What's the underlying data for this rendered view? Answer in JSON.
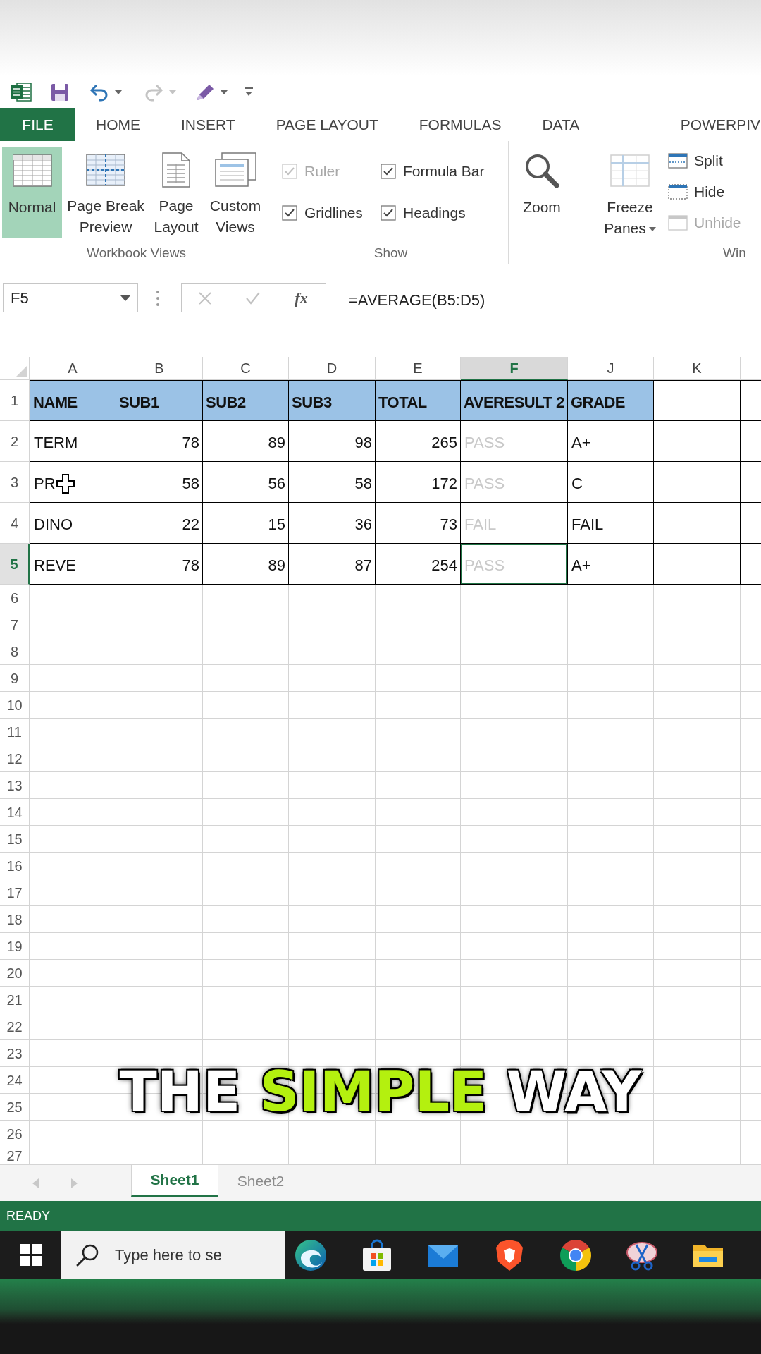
{
  "quick_access": [
    {
      "kind": "app"
    },
    {
      "kind": "save"
    },
    {
      "kind": "undo",
      "disabled": false
    },
    {
      "kind": "redo",
      "disabled": true
    },
    {
      "kind": "touch"
    },
    {
      "kind": "customize"
    }
  ],
  "ribbon_tabs": [
    {
      "label": "FILE",
      "kind": "backstage"
    },
    {
      "label": "HOME",
      "kind": "tab"
    },
    {
      "label": "INSERT",
      "kind": "tab"
    },
    {
      "label": "PAGE LAYOUT",
      "kind": "tab"
    },
    {
      "label": "FORMULAS",
      "kind": "tab"
    },
    {
      "label": "DATA",
      "kind": "tab"
    },
    {
      "label": "POWERPIV",
      "kind": "tab"
    }
  ],
  "ribbon": {
    "groups": [
      {
        "label": "Workbook Views",
        "kind": "views",
        "buttons": [
          {
            "label": "Normal",
            "kind": "normal",
            "selected": true
          },
          {
            "label": "Page Break Preview",
            "kind": "page_break",
            "selected": false
          },
          {
            "label": "Page Layout",
            "kind": "page_layout",
            "selected": false
          },
          {
            "label": "Custom Views",
            "kind": "custom",
            "selected": false
          }
        ]
      },
      {
        "label": "Show",
        "kind": "checks",
        "checkboxes": [
          {
            "label": "Ruler",
            "checked": true,
            "disabled": true
          },
          {
            "label": "Formula Bar",
            "checked": true,
            "disabled": false
          },
          {
            "label": "Gridlines",
            "checked": true,
            "disabled": false
          },
          {
            "label": "Headings",
            "checked": true,
            "disabled": false
          }
        ]
      },
      {
        "kind": "zoom",
        "buttons": [
          {
            "label": "Zoom",
            "kind": "zoom"
          },
          {
            "label": "Freeze Panes",
            "kind": "freeze"
          }
        ]
      },
      {
        "label": "Win",
        "kind": "window",
        "buttons": [
          {
            "label": "Split",
            "kind": "split",
            "disabled": false
          },
          {
            "label": "Hide",
            "kind": "hide",
            "disabled": false
          },
          {
            "label": "Unhide",
            "kind": "unhide",
            "disabled": true
          }
        ]
      }
    ]
  },
  "formula_bar": {
    "name_box": "F5",
    "buttons": [
      {
        "kind": "cancel",
        "disabled": true
      },
      {
        "kind": "enter",
        "disabled": true
      }
    ],
    "function_label": "fx",
    "formula": "=AVERAGE(B5:D5)"
  },
  "sheet": {
    "columns": [
      {
        "label": "A",
        "selected": false,
        "kind": "text"
      },
      {
        "label": "B",
        "selected": false,
        "kind": "number"
      },
      {
        "label": "C",
        "selected": false,
        "kind": "number"
      },
      {
        "label": "D",
        "selected": false,
        "kind": "number"
      },
      {
        "label": "E",
        "selected": false,
        "kind": "number"
      },
      {
        "label": "F",
        "selected": true,
        "kind": "text",
        "faded": true
      },
      {
        "label": "J",
        "selected": false,
        "kind": "text"
      },
      {
        "label": "K",
        "selected": false
      }
    ],
    "rows": [
      {
        "number": "1",
        "selected": false,
        "kind": "header",
        "cells": [
          {
            "text": "NAME"
          },
          {
            "text": "SUB1"
          },
          {
            "text": "SUB2"
          },
          {
            "text": "SUB3"
          },
          {
            "text": "TOTAL"
          },
          {
            "text": "AVERESULT 2"
          },
          {
            "text": "GRADE"
          }
        ]
      },
      {
        "number": "2",
        "selected": false,
        "kind": "data",
        "cells": [
          {
            "text": "TERM"
          },
          {
            "text": "78"
          },
          {
            "text": "89"
          },
          {
            "text": "98"
          },
          {
            "text": "265"
          },
          {
            "text": "PASS"
          },
          {
            "text": "A+"
          }
        ]
      },
      {
        "number": "3",
        "selected": false,
        "kind": "data",
        "cells": [
          {
            "text": "PR",
            "pointer": true
          },
          {
            "text": "58"
          },
          {
            "text": "56"
          },
          {
            "text": "58"
          },
          {
            "text": "172"
          },
          {
            "text": "PASS"
          },
          {
            "text": "C"
          }
        ]
      },
      {
        "number": "4",
        "selected": false,
        "kind": "data",
        "cells": [
          {
            "text": "DINO"
          },
          {
            "text": "22"
          },
          {
            "text": "15"
          },
          {
            "text": "36"
          },
          {
            "text": "73"
          },
          {
            "text": "FAIL"
          },
          {
            "text": "FAIL"
          }
        ]
      },
      {
        "number": "5",
        "selected": true,
        "kind": "data",
        "cells": [
          {
            "text": "REVE"
          },
          {
            "text": "78"
          },
          {
            "text": "89"
          },
          {
            "text": "87"
          },
          {
            "text": "254"
          },
          {
            "text": "PASS"
          },
          {
            "text": "A+"
          }
        ]
      }
    ],
    "empty_rows": [
      "6",
      "7",
      "8",
      "9",
      "10",
      "11",
      "12",
      "13",
      "14",
      "15",
      "16",
      "17",
      "18",
      "19",
      "20",
      "21",
      "22",
      "23",
      "24",
      "25",
      "26",
      "27"
    ]
  },
  "caption": [
    {
      "text": "THE",
      "color": "#ffffff"
    },
    {
      "text": "SIMPLE",
      "color": "#b4f00f"
    },
    {
      "text": "WAY",
      "color": "#ffffff"
    }
  ],
  "sheet_tabs": [
    {
      "label": "Sheet1",
      "selected": true
    },
    {
      "label": "Sheet2",
      "selected": false
    }
  ],
  "status_bar": {
    "text": "READY"
  },
  "taskbar": {
    "search": {
      "placeholder": "Type here to se"
    },
    "apps": [
      {
        "kind": "edge"
      },
      {
        "kind": "store"
      },
      {
        "kind": "mail"
      },
      {
        "kind": "brave"
      },
      {
        "kind": "chrome"
      },
      {
        "kind": "snip"
      },
      {
        "kind": "explorer"
      }
    ]
  }
}
